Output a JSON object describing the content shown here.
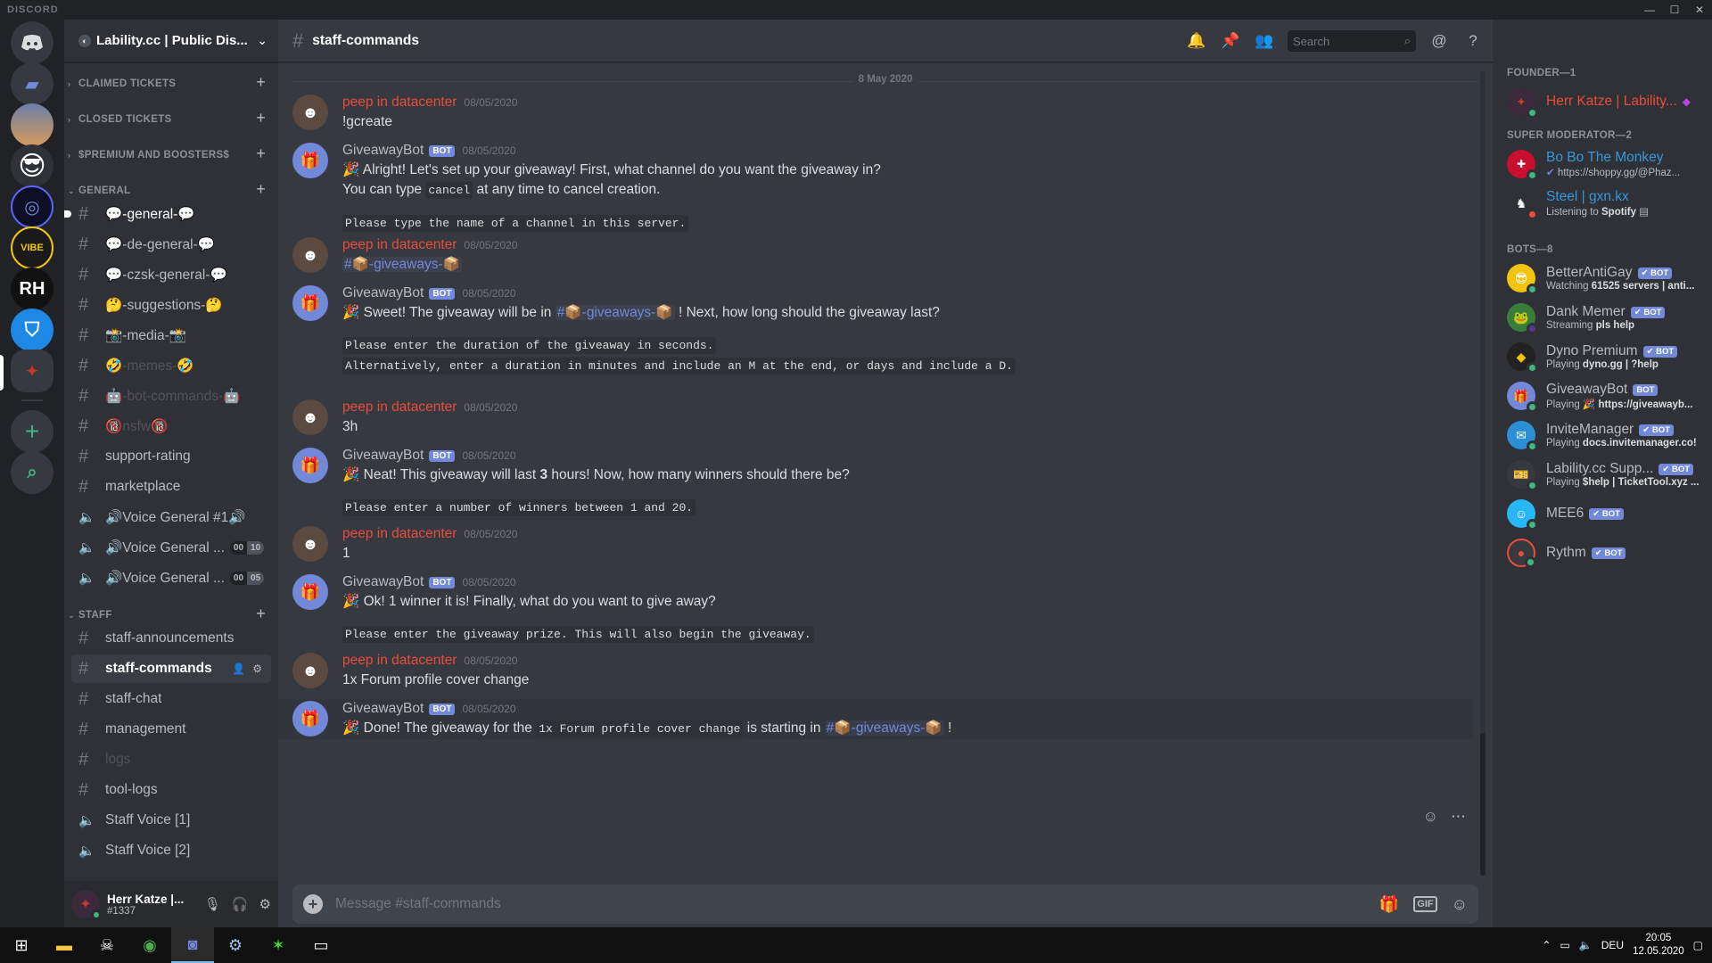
{
  "window": {
    "brand": "DISCORD",
    "controls": [
      "—",
      "☐",
      "✕"
    ]
  },
  "rail": {
    "home_icon": "discord-logo-icon"
  },
  "guild": {
    "name": "Lability.cc | Public Dis..."
  },
  "categories": {
    "claimed": "CLAIMED TICKETS",
    "closed": "CLOSED TICKETS",
    "premium": "$PREMIUM AND BOOSTERS$",
    "general": "GENERAL",
    "staff": "STAFF"
  },
  "channels": {
    "general": "💬-general-💬",
    "de_general": "💬-de-general-💬",
    "czsk_general": "💬-czsk-general-💬",
    "suggestions": "🤔-suggestions-🤔",
    "media": "📸-media-📸",
    "memes": "🤣-memes-🤣",
    "bot_commands": "🤖-bot-commands-🤖",
    "nsfw": "🔞nsfw🔞",
    "support_rating": "support-rating",
    "marketplace": "marketplace",
    "voice1": "🔊Voice General #1🔊",
    "voice2": "🔊Voice General ...",
    "voice2_count": [
      "00",
      "10"
    ],
    "voice3": "🔊Voice General ...",
    "voice3_count": [
      "00",
      "05"
    ],
    "staff_announcements": "staff-announcements",
    "staff_commands": "staff-commands",
    "staff_chat": "staff-chat",
    "management": "management",
    "logs": "logs",
    "tool_logs": "tool-logs",
    "staff_voice1": "Staff Voice [1]",
    "staff_voice2": "Staff Voice [2]"
  },
  "user": {
    "name": "Herr Katze |...",
    "tag": "#1337"
  },
  "header": {
    "channel": "staff-commands",
    "search_placeholder": "Search"
  },
  "date_divider": "8 May 2020",
  "bot_tag": "BOT",
  "messages": [
    {
      "author": "peep in datacenter",
      "time": "08/05/2020",
      "text": "!gcreate"
    },
    {
      "author": "GiveawayBot",
      "time": "08/05/2020",
      "l1": "Alright! Let's set up your giveaway! First, what channel do you want the giveaway in?",
      "l2a": "You can type ",
      "l2code": "cancel",
      "l2b": " at any time to cancel creation.",
      "code": "Please type the name of a channel in this server."
    },
    {
      "author": "peep in datacenter",
      "time": "08/05/2020",
      "mention": "#📦-giveaways-📦"
    },
    {
      "author": "GiveawayBot",
      "time": "08/05/2020",
      "l1a": "Sweet! The giveaway will be in ",
      "mention": "#📦-giveaways-📦",
      "l1b": " ! Next, how long should the giveaway last?",
      "code1": "Please enter the duration of the giveaway in seconds.",
      "code2": "Alternatively, enter a duration in minutes and include an M at the end, or days and include a D."
    },
    {
      "author": "peep in datacenter",
      "time": "08/05/2020",
      "text": "3h"
    },
    {
      "author": "GiveawayBot",
      "time": "08/05/2020",
      "l1a": "Neat! This giveaway will last ",
      "bold": "3",
      "l1b": " hours! Now, how many winners should there be?",
      "code": "Please enter a number of winners between 1 and 20."
    },
    {
      "author": "peep in datacenter",
      "time": "08/05/2020",
      "text": "1"
    },
    {
      "author": "GiveawayBot",
      "time": "08/05/2020",
      "l1": "Ok! 1 winner it is! Finally, what do you want to give away?",
      "code": "Please enter the giveaway prize. This will also begin the giveaway."
    },
    {
      "author": "peep in datacenter",
      "time": "08/05/2020",
      "text": "1x Forum profile cover change"
    },
    {
      "author": "GiveawayBot",
      "time": "08/05/2020",
      "l1a": "Done! The giveaway for the ",
      "code": "1x Forum profile cover change",
      "l1b": " is starting in ",
      "mention": "#📦-giveaways-📦",
      "l1c": " !"
    }
  ],
  "composer": {
    "placeholder": "Message #staff-commands",
    "gif": "GIF"
  },
  "members": {
    "founder_header": "FOUNDER—1",
    "supermod_header": "SUPER MODERATOR—2",
    "bots_header": "BOTS—8",
    "founder": {
      "name": "Herr Katze | Lability..."
    },
    "mod1": {
      "name": "Bo Bo The Monkey",
      "activity": "https://shoppy.gg/@Phaz..."
    },
    "mod2": {
      "name": "Steel | gxn.kx",
      "activity_pre": "Listening to ",
      "activity_b": "Spotify"
    },
    "bots": [
      {
        "name": "BetterAntiGay",
        "pre": "Watching ",
        "b": "61525 servers | anti..."
      },
      {
        "name": "Dank Memer",
        "pre": "Streaming ",
        "b": "pls help"
      },
      {
        "name": "Dyno Premium",
        "pre": "Playing ",
        "b": "dyno.gg | ?help"
      },
      {
        "name": "GiveawayBot",
        "pre": "Playing 🎉 ",
        "b": "https://giveawayb..."
      },
      {
        "name": "InviteManager",
        "pre": "Playing ",
        "b": "docs.invitemanager.co!"
      },
      {
        "name": "Lability.cc Supp...",
        "pre": "Playing ",
        "b": "$help | TicketTool.xyz ..."
      },
      {
        "name": "MEE6",
        "pre": "",
        "b": ""
      },
      {
        "name": "Rythm",
        "pre": "",
        "b": ""
      }
    ]
  },
  "taskbar": {
    "lang": "DEU",
    "time": "20:05",
    "date": "12.05.2020"
  },
  "colors": {
    "accent": "#7289da",
    "red_author": "#e74c3c",
    "online": "#43b581"
  }
}
